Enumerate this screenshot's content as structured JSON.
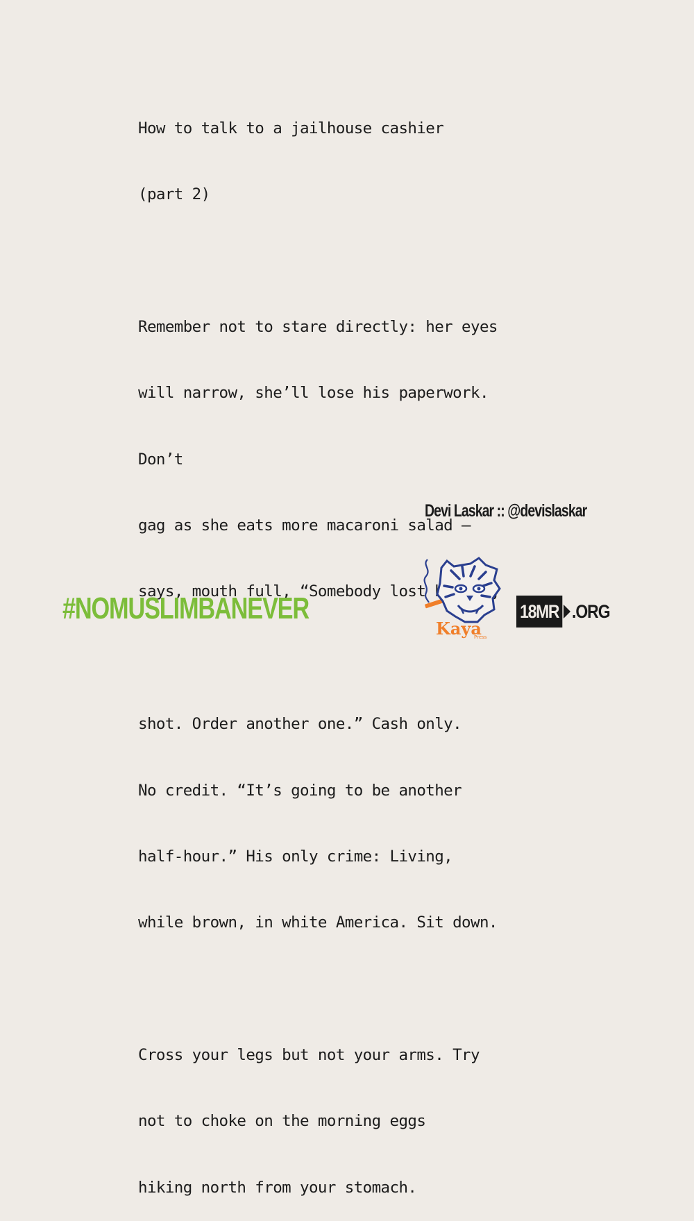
{
  "poem": {
    "title_lines": [
      "How to talk to a jailhouse cashier",
      "(part 2)"
    ],
    "stanza1": [
      "Remember not to stare directly: her eyes",
      "will narrow, she’ll lose his paperwork.",
      "Don’t",
      "gag as she eats more macaroni salad –",
      "says, mouth full, “Somebody lost his mug"
    ],
    "stanza2": [
      "shot. Order another one.” Cash only.",
      "No credit. “It’s going to be another",
      "half-hour.” His only crime: Living,",
      "while brown, in white America. Sit down."
    ],
    "stanza3": [
      "Cross your legs but not your arms. Try",
      "not to choke on the morning eggs",
      "hiking north from your stomach."
    ]
  },
  "author_credit": "Devi Laskar :: @devislaskar",
  "hashtag": "#NOMUSLIMBANEVER",
  "kaya_logo": {
    "name": "Kaya",
    "sub": "Press",
    "icon": "tiger-icon",
    "blue": "#2a3f8f",
    "orange": "#f07f2a"
  },
  "mr_logo": {
    "box_text": "18MR",
    "suffix": ".ORG"
  },
  "colors": {
    "background": "#efebe6",
    "hashtag": "#7cbd3a",
    "text": "#1c1c1c"
  }
}
